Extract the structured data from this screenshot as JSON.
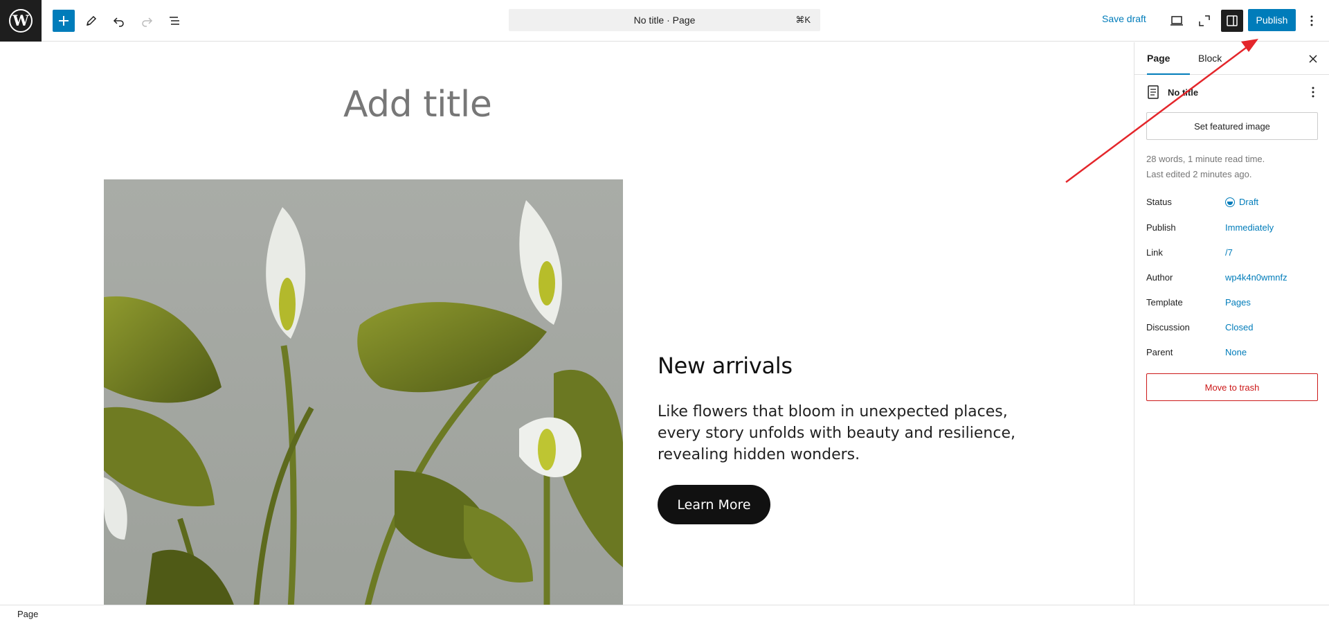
{
  "header": {
    "doc_title": "No title · Page",
    "shortcut": "⌘K",
    "save_draft": "Save draft",
    "publish": "Publish"
  },
  "canvas": {
    "title_placeholder": "Add title",
    "heading": "New arrivals",
    "paragraph": "Like flowers that bloom in unexpected places, every story unfolds with beauty and resilience, revealing hidden wonders.",
    "button": "Learn More"
  },
  "sidebar": {
    "tabs": [
      "Page",
      "Block"
    ],
    "doc_title": "No title",
    "featured_image": "Set featured image",
    "meta_words": "28 words, 1 minute read time.",
    "meta_edited": "Last edited 2 minutes ago.",
    "rows": [
      {
        "label": "Status",
        "value": "Draft"
      },
      {
        "label": "Publish",
        "value": "Immediately"
      },
      {
        "label": "Link",
        "value": "/7"
      },
      {
        "label": "Author",
        "value": "wp4k4n0wmnfz"
      },
      {
        "label": "Template",
        "value": "Pages"
      },
      {
        "label": "Discussion",
        "value": "Closed"
      },
      {
        "label": "Parent",
        "value": "None"
      }
    ],
    "trash": "Move to trash"
  },
  "footer": {
    "breadcrumb": "Page"
  },
  "colors": {
    "accent": "#007cba",
    "danger": "#cc1818",
    "annotation_arrow": "#e4262b"
  }
}
